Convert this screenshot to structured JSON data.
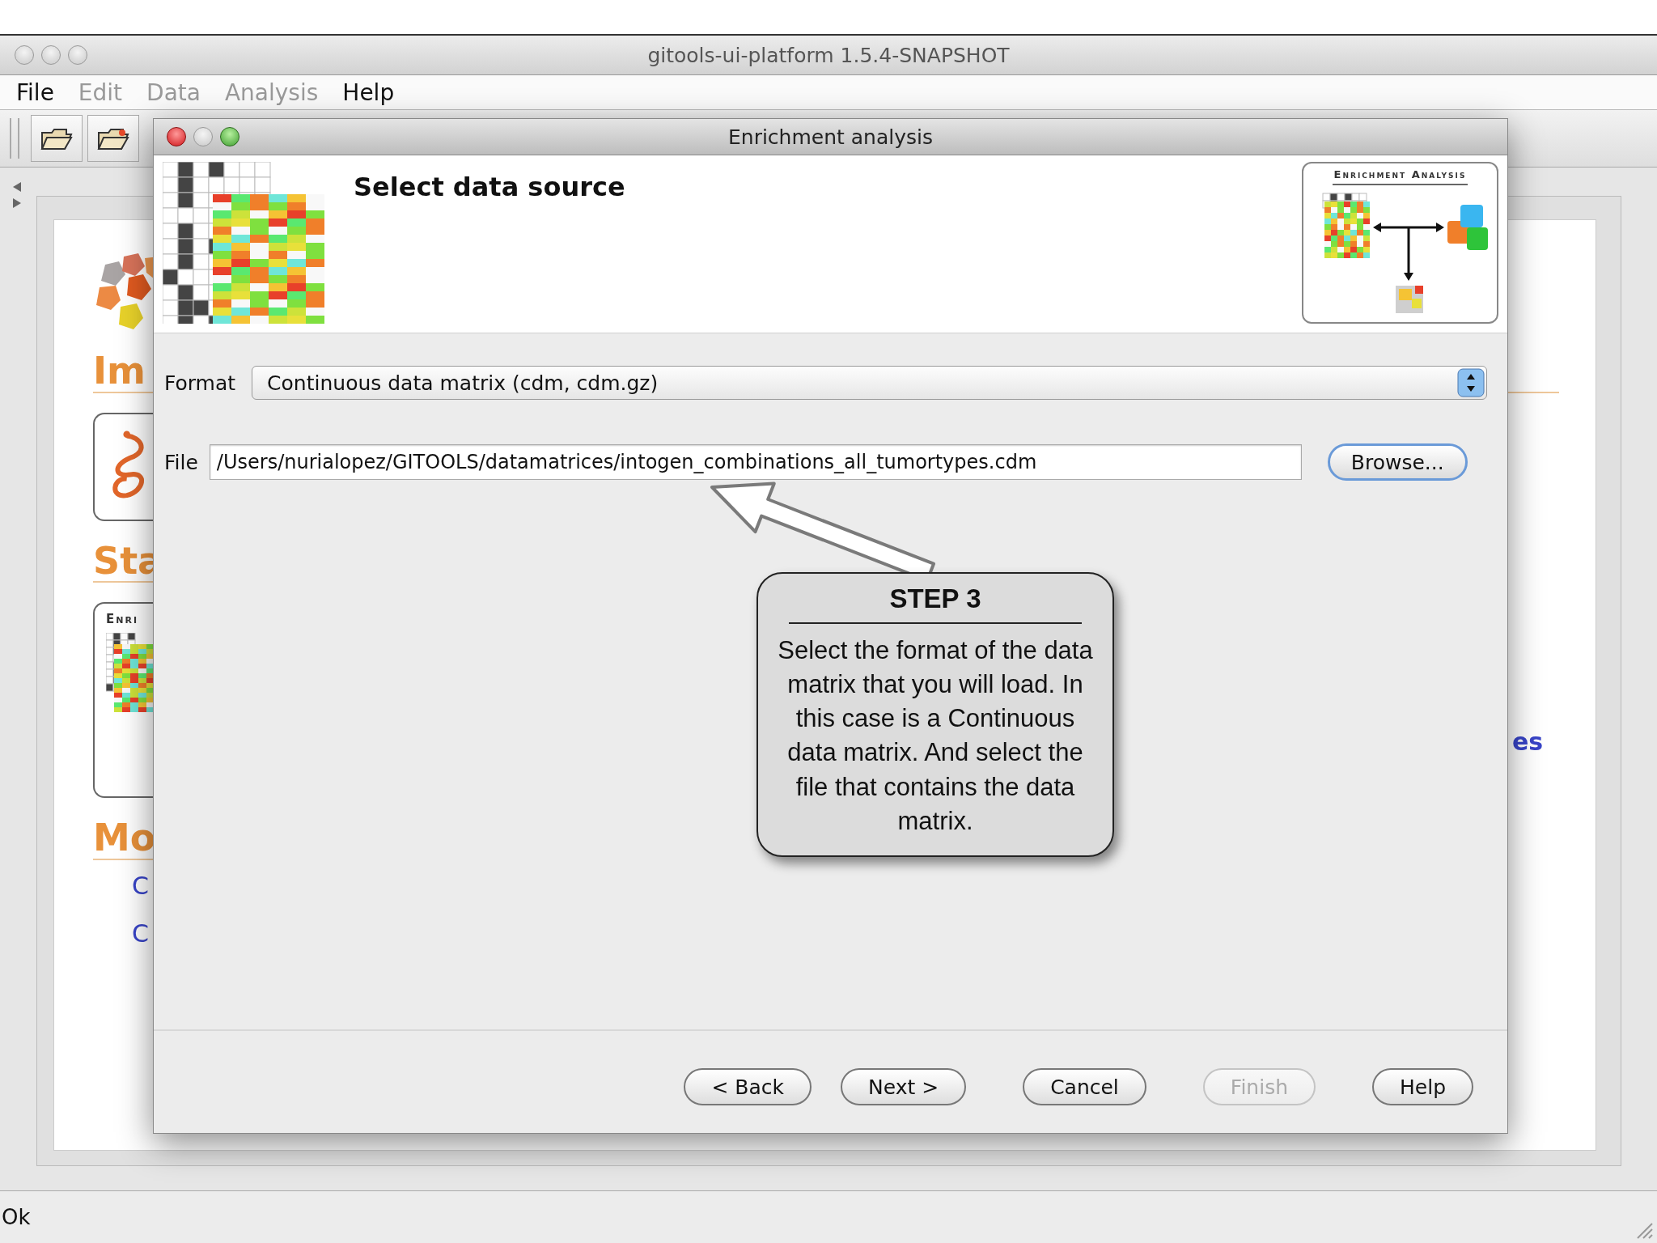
{
  "main_window": {
    "title": "gitools-ui-platform 1.5.4-SNAPSHOT",
    "menu": [
      {
        "label": "File",
        "disabled": false
      },
      {
        "label": "Edit",
        "disabled": true
      },
      {
        "label": "Data",
        "disabled": true
      },
      {
        "label": "Analysis",
        "disabled": true
      },
      {
        "label": "Help",
        "disabled": false
      }
    ],
    "background": {
      "headings": [
        "Im",
        "Sta",
        "Mo"
      ],
      "card_caption": "Enri",
      "links": [
        "C",
        "C"
      ],
      "right_link": "es"
    },
    "status_bar": "Ok"
  },
  "dialog": {
    "title": "Enrichment analysis",
    "heading": "Select data source",
    "logo_caption": "Enrichment Analysis",
    "format": {
      "label": "Format",
      "value": "Continuous data matrix (cdm, cdm.gz)"
    },
    "file": {
      "label": "File",
      "value": "/Users/nurialopez/GITOOLS/datamatrices/intogen_combinations_all_tumortypes.cdm"
    },
    "browse": "Browse...",
    "buttons": [
      {
        "label": "< Back",
        "disabled": false
      },
      {
        "label": "Next >",
        "disabled": false
      },
      {
        "label": "Cancel",
        "disabled": false
      },
      {
        "label": "Finish",
        "disabled": true
      },
      {
        "label": "Help",
        "disabled": false
      }
    ]
  },
  "callout": {
    "title": "STEP 3",
    "text": "Select the format of the data matrix that you will load. In this case is a Continuous data matrix. And select the file that contains the data matrix."
  }
}
